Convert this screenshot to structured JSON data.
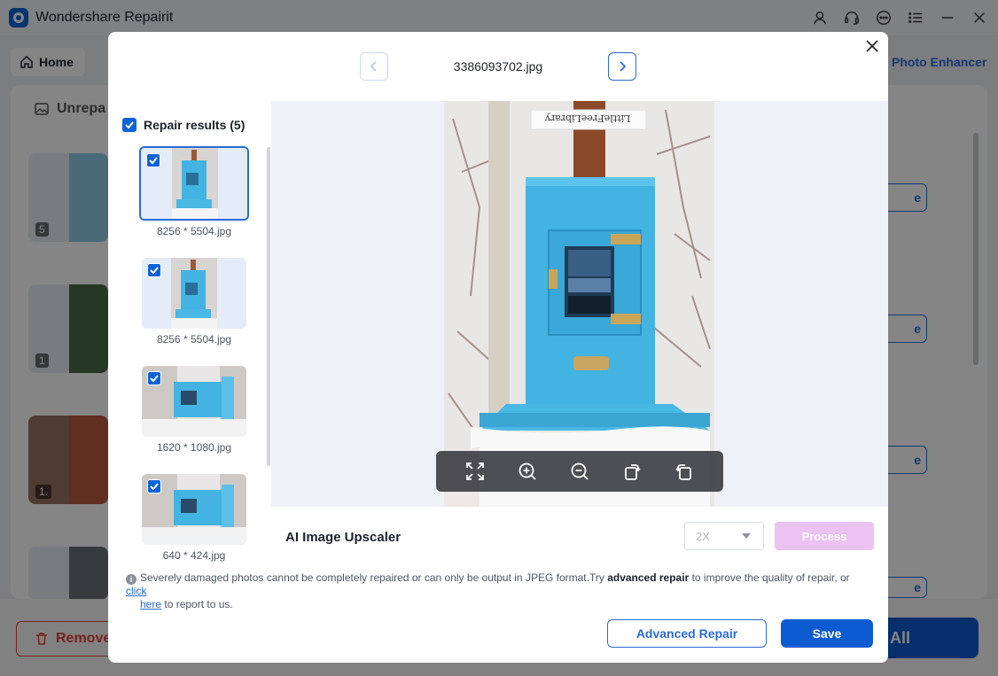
{
  "app": {
    "title": "Wondershare Repairit",
    "home_tab": "Home",
    "photo_enhancer": "Photo Enhancer",
    "unrepaired_label": "Unrepa",
    "thumb_counts": [
      "5",
      "1",
      "1."
    ],
    "row_button_label": "e",
    "remove_label": "Remove",
    "save_all_label": "All",
    "icons": [
      "user-icon",
      "headset-icon",
      "chat-icon",
      "menu-icon",
      "minimize-icon",
      "close-icon"
    ]
  },
  "modal": {
    "filename": "3386093702.jpg",
    "sidebar": {
      "title": "Repair results (5)",
      "items": [
        {
          "label": "8256 * 5504.jpg",
          "checked": true,
          "selected": true
        },
        {
          "label": "8256 * 5504.jpg",
          "checked": true,
          "selected": false
        },
        {
          "label": "1620 * 1080.jpg",
          "checked": true,
          "selected": false
        },
        {
          "label": "640 * 424.jpg",
          "checked": true,
          "selected": false
        }
      ]
    },
    "preview": {
      "sign_text": "LittleFreeLibrary",
      "tools": [
        "fullscreen-icon",
        "zoom-in-icon",
        "zoom-out-icon",
        "rotate-left-icon",
        "rotate-right-icon"
      ]
    },
    "upscaler": {
      "label": "AI Image Upscaler",
      "scale_value": "2X",
      "process_label": "Process"
    },
    "notice": {
      "text_before": "Severely damaged photos cannot be completely repaired or can only be output in JPEG format.Try ",
      "bold": "advanced repair",
      "text_middle": " to improve the quality of repair, or ",
      "link1": "click",
      "link2": "here",
      "text_after": " to report to us."
    },
    "buttons": {
      "advanced_repair": "Advanced Repair",
      "save": "Save"
    }
  },
  "colors": {
    "accent": "#0c5bd0",
    "link": "#2a6bd6",
    "process_disabled": "#ebc2f2",
    "box_blue": "#3fb4e0",
    "danger": "#e0443a"
  }
}
